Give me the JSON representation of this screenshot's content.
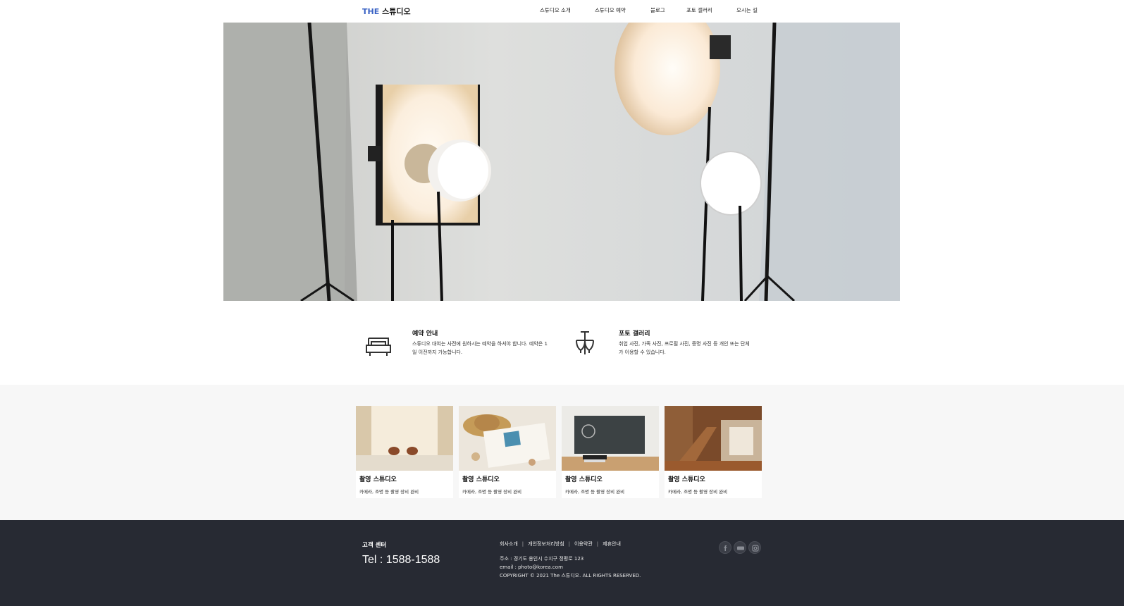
{
  "header": {
    "logo_the": "THE",
    "logo_name": "스튜디오",
    "nav": [
      "스튜디오 소개",
      "스튜디오 예약",
      "블로그",
      "포토 갤러리",
      "오시는 길"
    ]
  },
  "info": [
    {
      "title": "예약 안내",
      "text": "스튜디오 대여는 사전에 원하시는 예약을 하셔야 합니다. 예약은 1일 이전까지 가능합니다.",
      "icon": "sofa-icon"
    },
    {
      "title": "포토 갤러리",
      "text": "취업 사진, 가족 사진, 프로필 사진, 증명 사진 등 개인 또는 단체가 이용할 수 있습니다.",
      "icon": "chandelier-icon"
    }
  ],
  "gallery": [
    {
      "title": "촬영 스튜디오",
      "desc": "카메라, 조명 등 촬영 장비 완비"
    },
    {
      "title": "촬영 스튜디오",
      "desc": "카메라, 조명 등 촬영 장비 완비"
    },
    {
      "title": "촬영 스튜디오",
      "desc": "카메라, 조명 등 촬영 장비 완비"
    },
    {
      "title": "촬영 스튜디오",
      "desc": "카메라, 조명 등 촬영 장비 완비"
    }
  ],
  "footer": {
    "cs_title": "고객 센터",
    "tel": "Tel : 1588-1588",
    "links": [
      "회사소개",
      "개인정보처리방침",
      "이용약관",
      "제휴안내"
    ],
    "address": "주소 : 경기도 용인시 수지구 정평로 123",
    "email": "email : photo@korea.com",
    "copyright": "COPYRIGHT © 2021 The 스튜디오. ALL RIGHTS RESERVED.",
    "social_icons": [
      "facebook-icon",
      "blog-icon",
      "instagram-icon"
    ]
  },
  "colors": {
    "accent": "#3a62c4",
    "footer_bg": "#272a33",
    "gallery_bg": "#f7f7f7"
  }
}
